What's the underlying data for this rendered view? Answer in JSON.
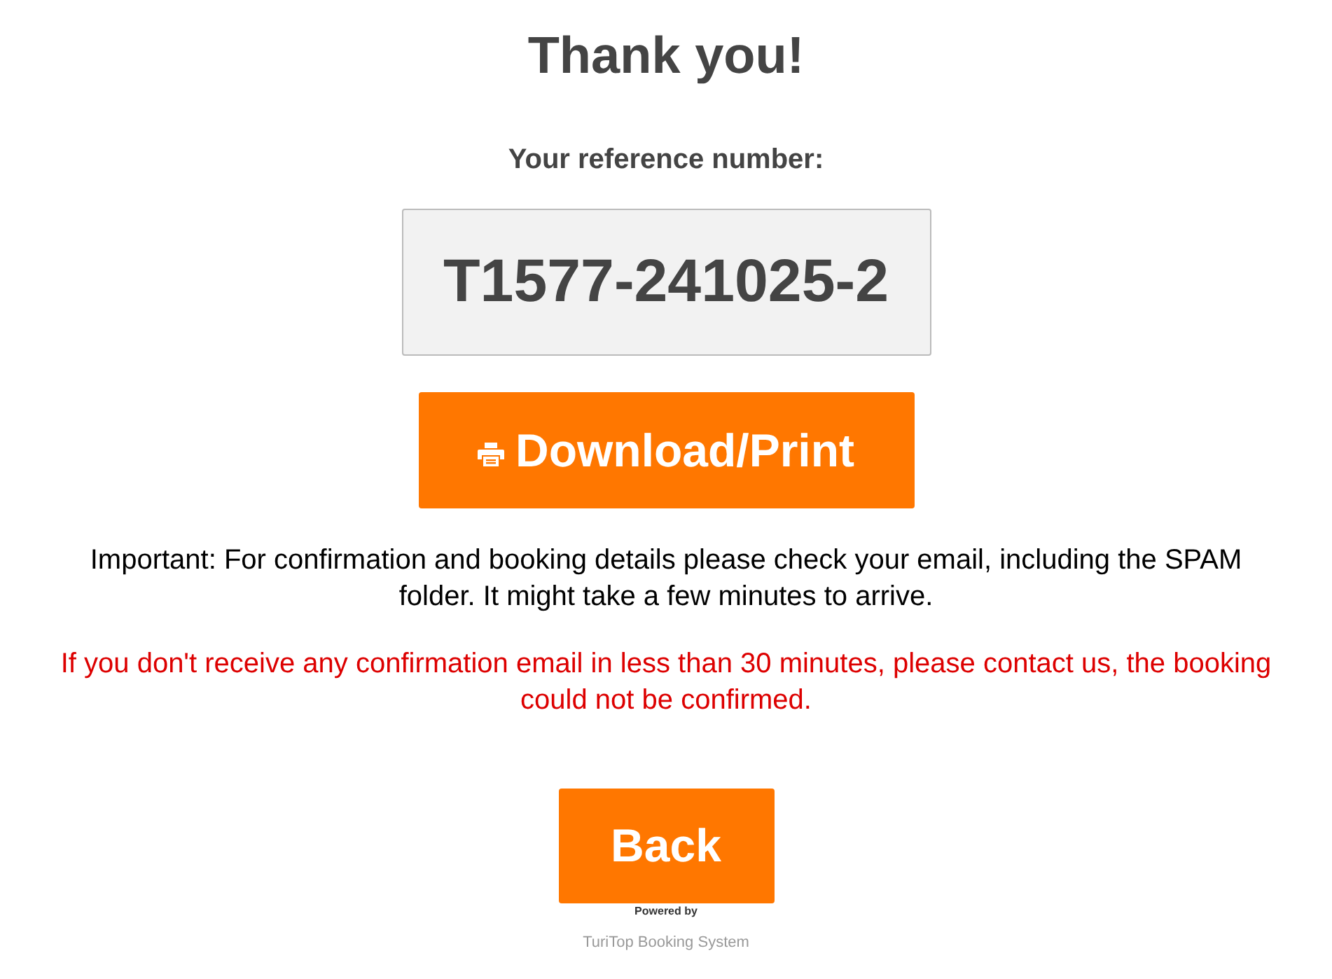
{
  "title": "Thank you!",
  "reference": {
    "label": "Your reference number:",
    "value": "T1577-241025-2"
  },
  "download_button": "Download/Print",
  "notice": "Important: For confirmation and booking details please check your email, including the SPAM folder. It might take a few minutes to arrive.",
  "warning": "If you don't receive any confirmation email in less than 30 minutes, please contact us, the booking could not be confirmed.",
  "back_button": "Back",
  "footer": {
    "powered_by": "Powered by",
    "brand": "TuriTop Booking System"
  }
}
